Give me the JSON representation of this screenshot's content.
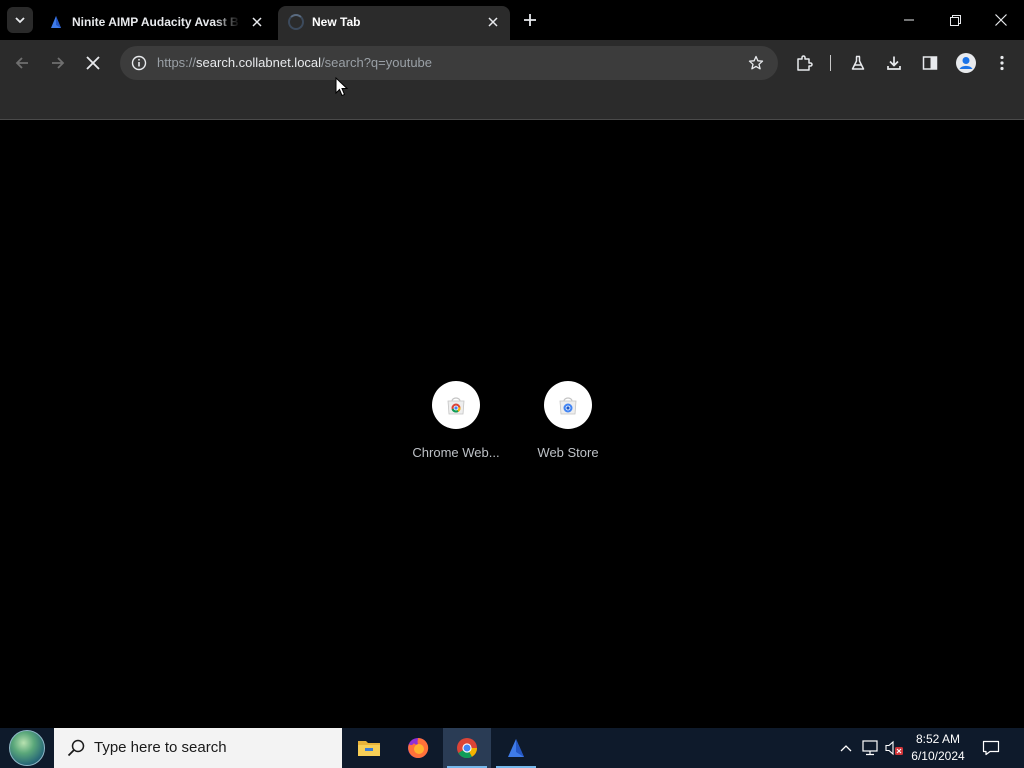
{
  "browser": {
    "tabs": [
      {
        "title": "Ninite AIMP Audacity Avast Bl",
        "state": "inactive",
        "favicon": "ninite-icon"
      },
      {
        "title": "New Tab",
        "state": "active",
        "favicon": "loading-spinner-icon"
      }
    ],
    "omnibox": {
      "url_scheme": "https://",
      "url_host": "search.collabnet.local",
      "url_path": "/search?q=youtube"
    },
    "shortcuts": [
      {
        "label": "Chrome Web...",
        "icon": "chrome-web-store-icon"
      },
      {
        "label": "Web Store",
        "icon": "web-store-icon"
      }
    ]
  },
  "taskbar": {
    "search_placeholder": "Type here to search",
    "apps": [
      "file-explorer-icon",
      "firefox-icon",
      "chrome-icon",
      "ninite-icon"
    ],
    "active_app": "chrome-icon",
    "clock_time": "8:52 AM",
    "clock_date": "6/10/2024"
  },
  "colors": {
    "background": "#000000",
    "toolbar": "#2b2b2b",
    "omnibox": "#3c3c3c",
    "taskbar": "#0e1a2b",
    "accent": "#76b9ed"
  }
}
